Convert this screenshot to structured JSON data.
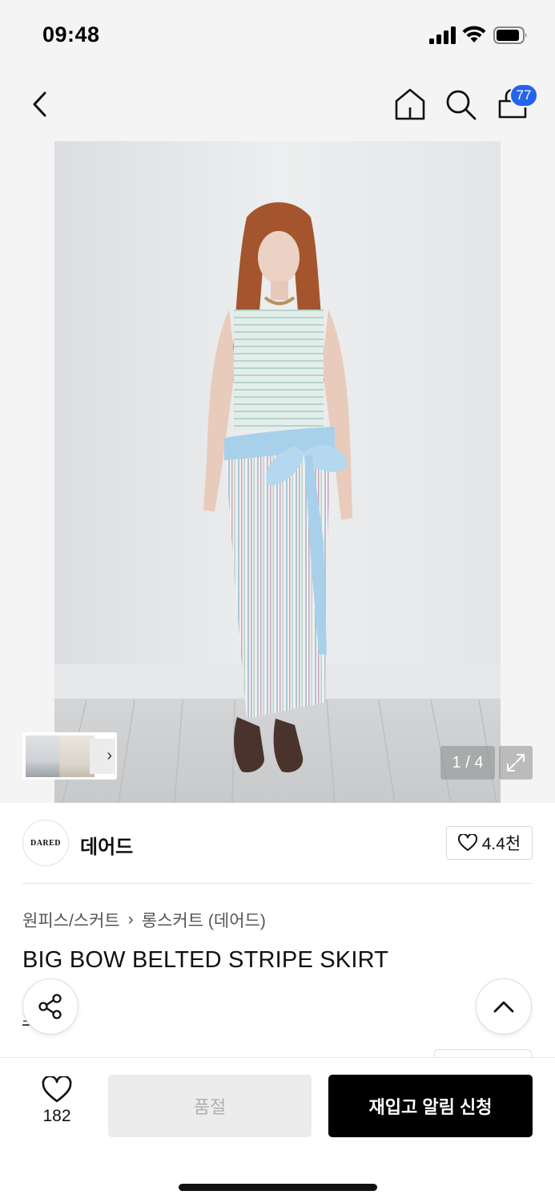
{
  "status_bar": {
    "time": "09:48"
  },
  "nav": {
    "cart_count": "77"
  },
  "gallery": {
    "counter": "1 / 4",
    "thumb_arrow": "›"
  },
  "brand": {
    "logo_text": "DARED",
    "name": "데어드",
    "likes": "4.4천"
  },
  "product": {
    "breadcrumb": [
      "원피스/스커트",
      "›",
      "롱스커트 (데어드)"
    ],
    "title": "BIG BOW BELTED STRIPE SKIRT",
    "sub_link": "소개"
  },
  "bottom_bar": {
    "like_count": "182",
    "soldout_label": "품절",
    "restock_label": "재입고 알림 신청"
  },
  "colors": {
    "accent_badge": "#2563eb",
    "primary_button": "#000000",
    "disabled_button": "#ececec"
  }
}
